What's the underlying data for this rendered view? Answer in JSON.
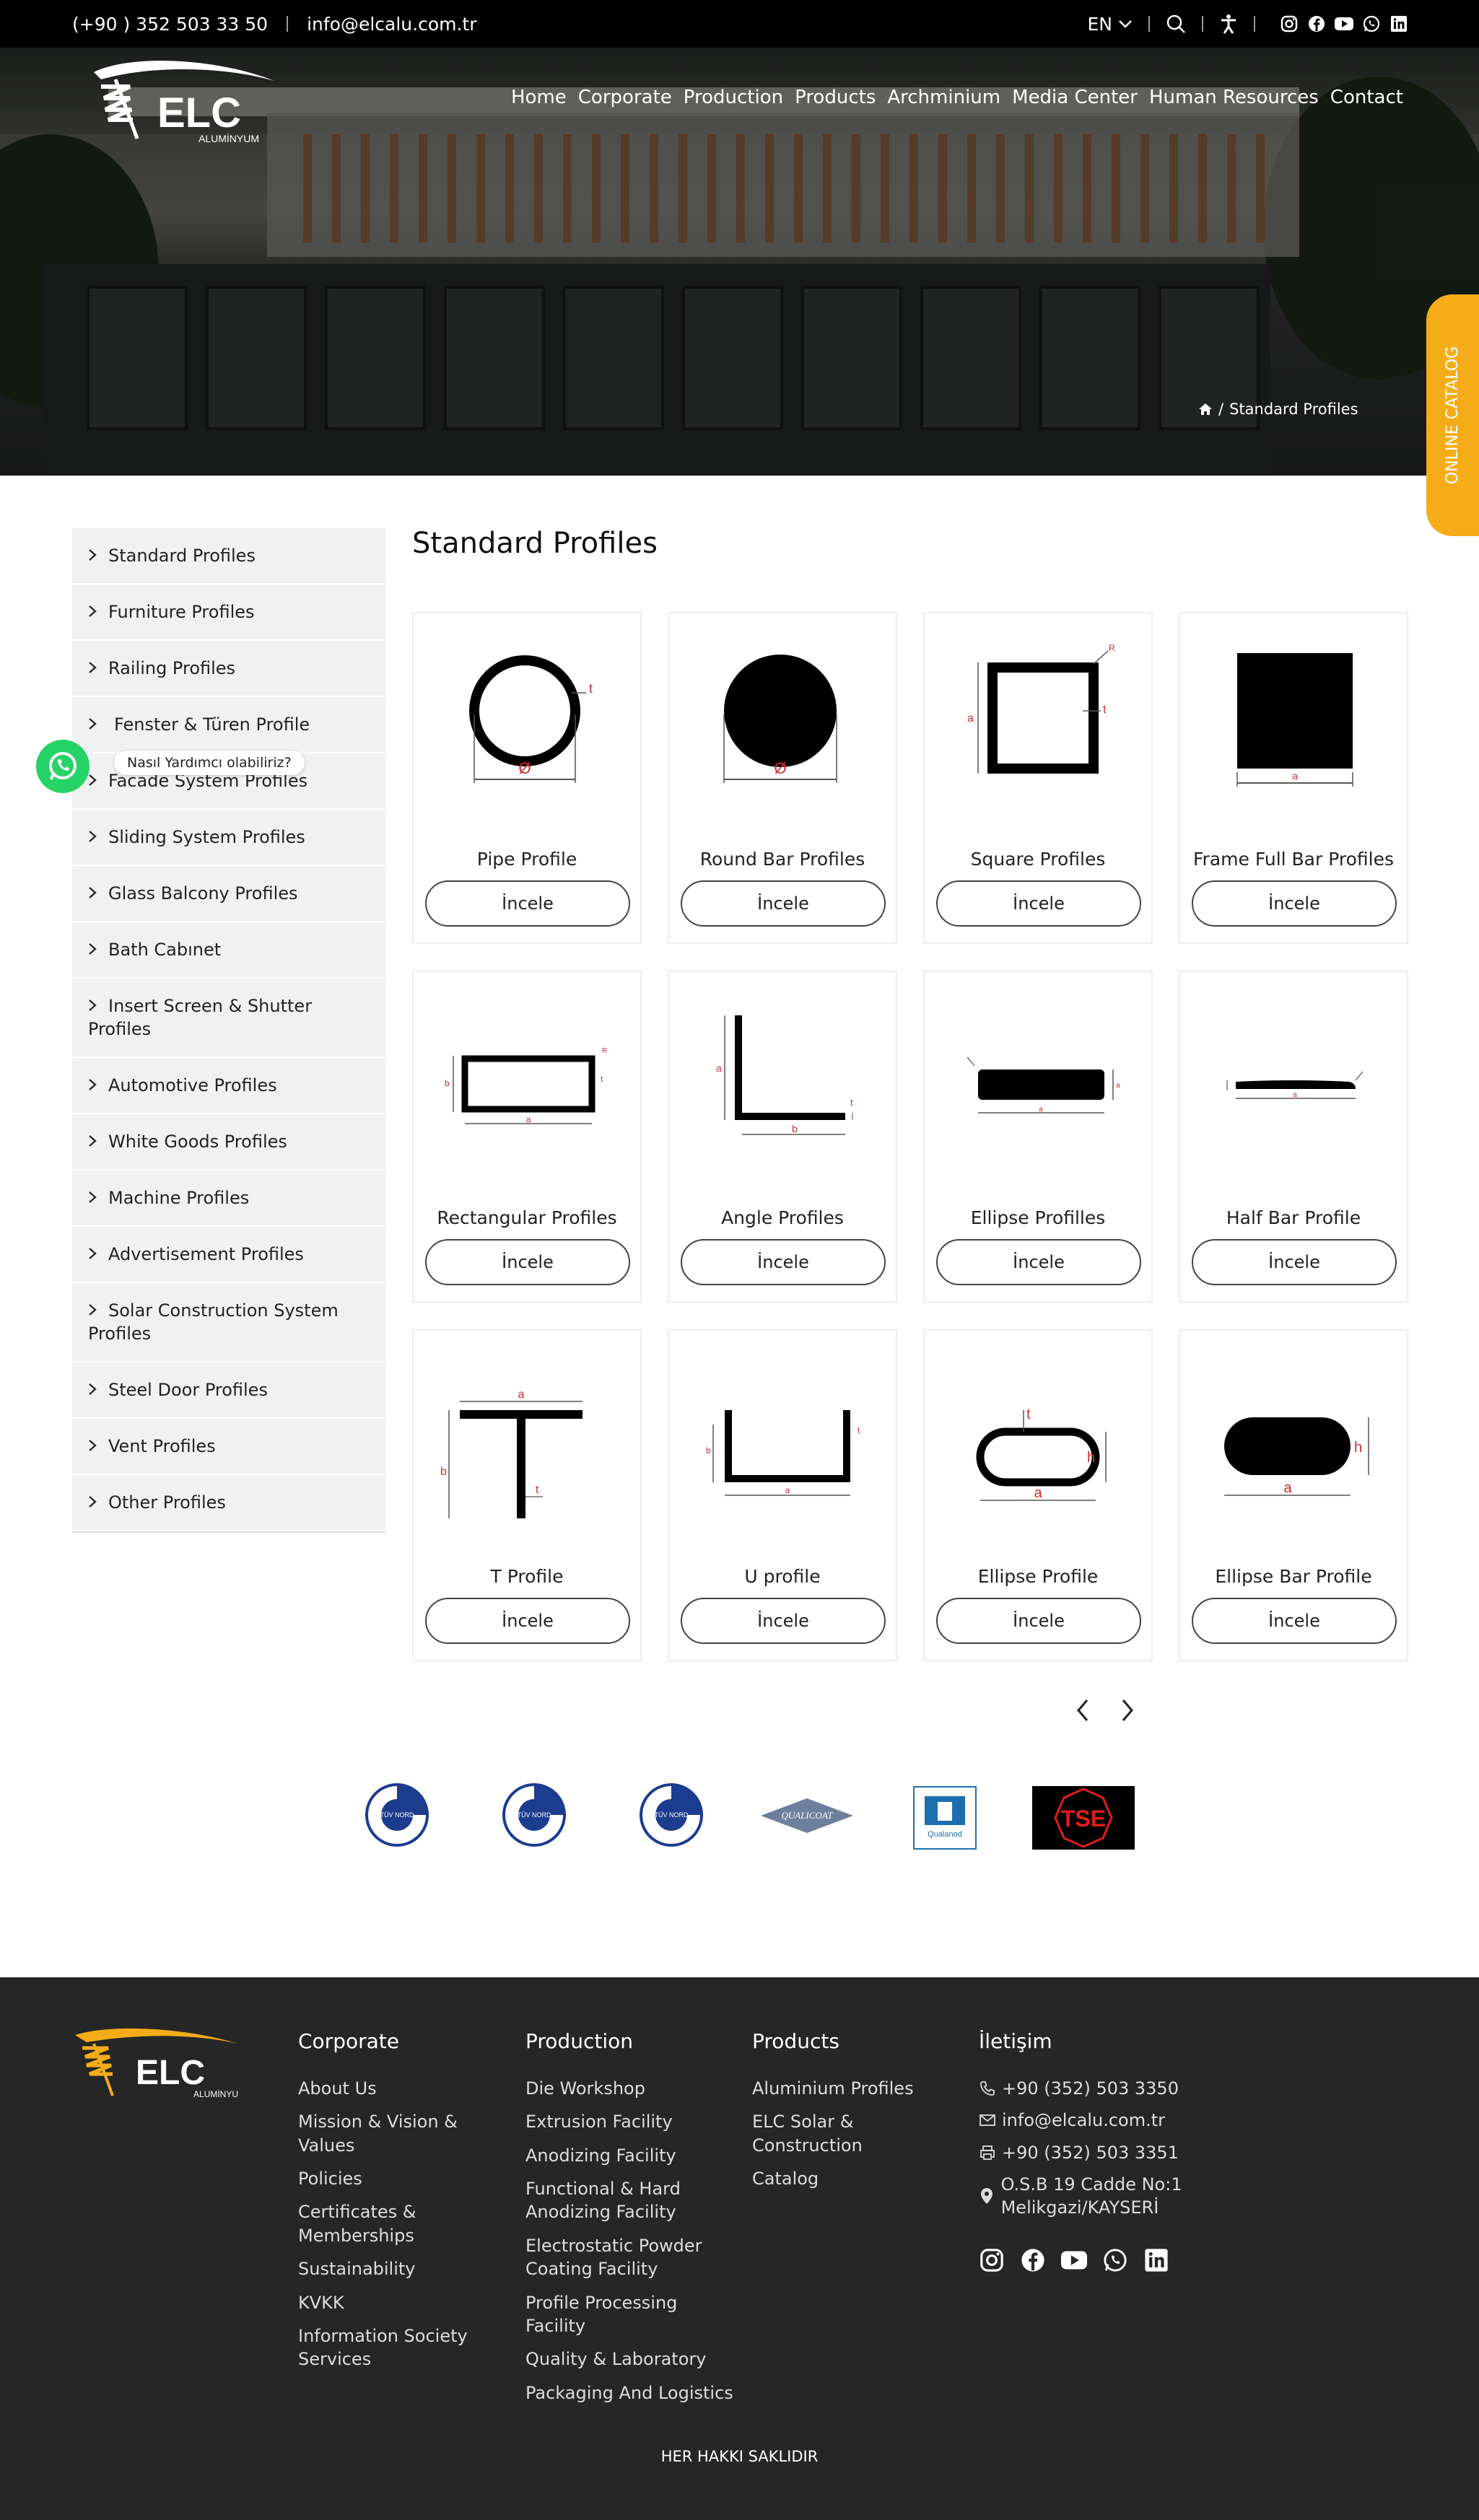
{
  "topbar": {
    "phone": "(+90 ) 352 503 33 50",
    "email": "info@elcalu.com.tr",
    "language": "EN"
  },
  "brand": {
    "name": "ELC",
    "sub": "ALUMİNYUM",
    "accent": "#f4ad19"
  },
  "nav": [
    "Home",
    "Corporate",
    "Production",
    "Products",
    "Archminium",
    "Media Center",
    "Human Resources",
    "Contact"
  ],
  "breadcrumb": {
    "separator": "/",
    "current": "Standard Profiles"
  },
  "catalog_tab": "ONLINE CATALOG",
  "sidebar": {
    "items": [
      "Standard Profiles",
      "Furniture Profiles",
      "Railing Profiles",
      "Fenster & Türen Profile",
      "Facade System Profiles",
      "Sliding System Profiles",
      "Glass Balcony Profiles",
      "Bath Cabınet",
      "Insert Screen & Shutter Profiles",
      "Automotive Profiles",
      "White Goods Profiles",
      "Machine Profiles",
      "Advertisement Profiles",
      "Solar Construction System Profiles",
      "Steel Door Profiles",
      "Vent Profiles",
      "Other Profiles"
    ]
  },
  "whatsapp": {
    "tooltip": "Nasıl Yardımcı olabiliriz?"
  },
  "main": {
    "title": "Standard Profiles",
    "button_label": "İncele",
    "products": [
      {
        "name": "Pipe Profile",
        "icon": "pipe-diagram"
      },
      {
        "name": "Round Bar Profiles",
        "icon": "round-bar-diagram"
      },
      {
        "name": "Square Profiles",
        "icon": "square-diagram"
      },
      {
        "name": "Frame Full Bar Profiles",
        "icon": "full-bar-diagram"
      },
      {
        "name": "Rectangular Profiles",
        "icon": "rectangular-diagram"
      },
      {
        "name": "Angle Profiles",
        "icon": "angle-diagram"
      },
      {
        "name": "Ellipse Profilles",
        "icon": "ellipse-flat-diagram"
      },
      {
        "name": "Half Bar Profile",
        "icon": "half-bar-diagram"
      },
      {
        "name": "T Profile",
        "icon": "t-diagram"
      },
      {
        "name": "U profile",
        "icon": "u-diagram"
      },
      {
        "name": "Ellipse Profile",
        "icon": "ellipse-tube-diagram"
      },
      {
        "name": "Ellipse Bar Profile",
        "icon": "ellipse-bar-diagram"
      }
    ]
  },
  "certificates": [
    {
      "name": "tuv-nord-1",
      "text": "TÜV NORD"
    },
    {
      "name": "tuv-nord-2",
      "text": "TÜV NORD"
    },
    {
      "name": "tuv-nord-3",
      "text": "TÜV NORD"
    },
    {
      "name": "qualicoat",
      "text": "QUALICOAT"
    },
    {
      "name": "qualanod",
      "text": "Qualanod"
    },
    {
      "name": "tse",
      "text": "TSE"
    }
  ],
  "footer": {
    "cols": [
      {
        "title": "Corporate",
        "items": [
          "About Us",
          "Mission & Vision & Values",
          "Policies",
          "Certificates & Memberships",
          "Sustainability",
          "KVKK",
          "Information Society Services"
        ]
      },
      {
        "title": "Production",
        "items": [
          "Die Workshop",
          "Extrusion Facility",
          "Anodizing Facility",
          "Functional & Hard Anodizing Facility",
          "Electrostatic Powder Coating Facility",
          "Profile Processing Facility",
          "Quality & Laboratory",
          "Packaging And Logistics"
        ]
      },
      {
        "title": "Products",
        "items": [
          "Aluminium Profiles",
          "ELC Solar & Construction",
          "Catalog"
        ]
      }
    ],
    "contact": {
      "title": "İletişim",
      "phone": "+90 (352) 503 3350",
      "email": "info@elcalu.com.tr",
      "fax": "+90 (352) 503 3351",
      "address": "O.S.B 19 Cadde No:1 Melikgazi/KAYSERİ"
    },
    "copyright": "HER HAKKI SAKLIDIR"
  }
}
